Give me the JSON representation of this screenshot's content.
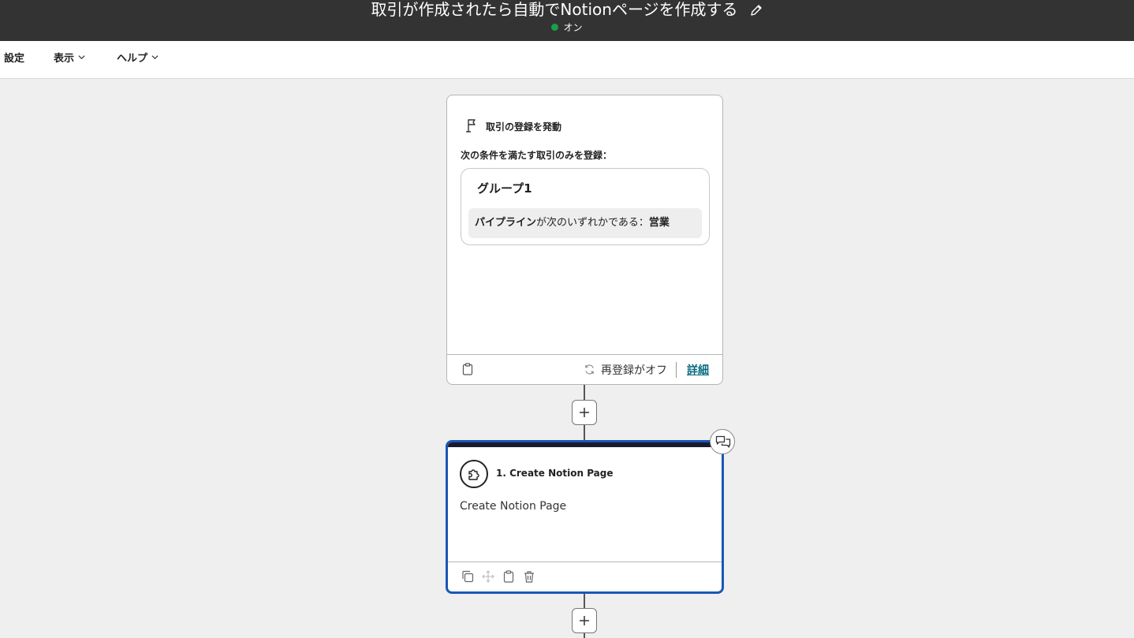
{
  "header": {
    "title": "取引が作成されたら自動でNotionページを作成する",
    "status_label": "オン",
    "status_color": "#1a9e4b"
  },
  "menu": {
    "items": [
      {
        "label": "設定",
        "has_dropdown": false
      },
      {
        "label": "表示",
        "has_dropdown": true
      },
      {
        "label": "ヘルプ",
        "has_dropdown": true
      }
    ]
  },
  "trigger": {
    "title": "取引の登録を発動",
    "condition_label": "次の条件を満たす取引のみを登録：",
    "group": {
      "title": "グループ1",
      "filter": {
        "property": "パイプライン",
        "operator": "が次のいずれかである：",
        "value": "営業"
      }
    },
    "reenroll_label": "再登録がオフ",
    "details_label": "詳細"
  },
  "action": {
    "title": "1. Create Notion Page",
    "description": "Create Notion Page",
    "accent_color": "#1a57b8"
  },
  "icons": {
    "edit": "pencil-icon",
    "trigger": "flag-icon",
    "app": "puzzle-icon",
    "comment": "comment-icon"
  }
}
